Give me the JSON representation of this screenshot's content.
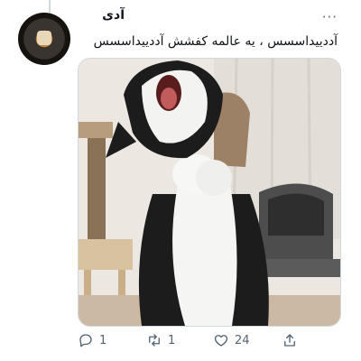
{
  "tweet": {
    "author_name": "آدی",
    "text": "آددییداسسس ، یه عالمه کفشش آددییداسسس",
    "more_icon": "more-icon",
    "media": {
      "alt": "black and white cat screaming with paws together",
      "icon": "photo"
    }
  },
  "actions": {
    "reply": {
      "icon": "reply-icon",
      "count": "1"
    },
    "retweet": {
      "icon": "retweet-icon",
      "count": "1"
    },
    "like": {
      "icon": "like-icon",
      "count": "24"
    },
    "share": {
      "icon": "share-icon"
    }
  },
  "colors": {
    "text": "#0f1419",
    "muted": "#536471",
    "border": "#cfd9de"
  }
}
